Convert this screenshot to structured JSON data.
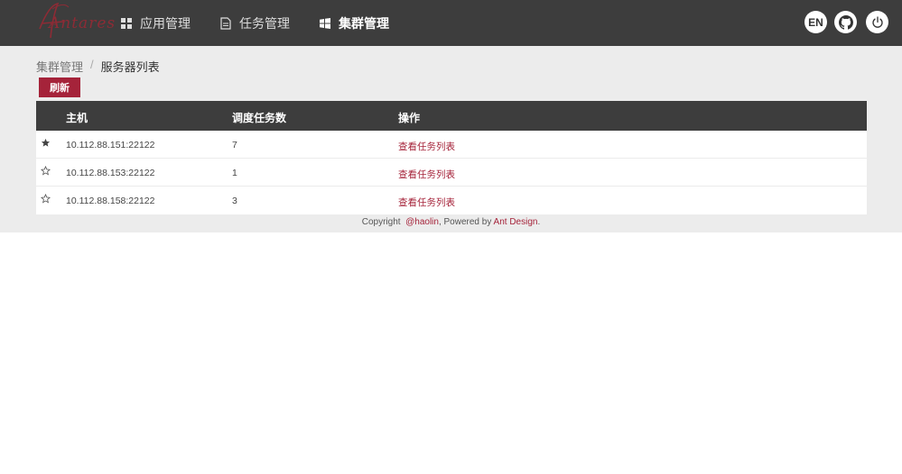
{
  "header": {
    "logo_text": "Antares",
    "nav": [
      {
        "label": "应用管理",
        "icon": "grid-icon"
      },
      {
        "label": "任务管理",
        "icon": "file-icon"
      },
      {
        "label": "集群管理",
        "icon": "windows-icon",
        "active": true
      }
    ],
    "lang_label": "EN",
    "github_icon": "github-icon",
    "power_icon": "power-icon"
  },
  "breadcrumb": {
    "parent": "集群管理",
    "separator": "/",
    "current": "服务器列表"
  },
  "refresh_label": "刷新",
  "table": {
    "columns": [
      "主机",
      "调度任务数",
      "操作"
    ],
    "rows": [
      {
        "host": "10.112.88.151:22122",
        "count": "7",
        "action": "查看任务列表",
        "starred": true
      },
      {
        "host": "10.112.88.153:22122",
        "count": "1",
        "action": "查看任务列表",
        "starred": false
      },
      {
        "host": "10.112.88.158:22122",
        "count": "3",
        "action": "查看任务列表",
        "starred": false
      }
    ]
  },
  "footer": {
    "prefix": "Copyright",
    "author": "@haolin",
    "middle": ", Powered by ",
    "brand": "Ant Design",
    "suffix": "."
  },
  "colors": {
    "header_bg": "#3d3d3d",
    "accent": "#a5233a",
    "content_bg": "#ececec"
  }
}
